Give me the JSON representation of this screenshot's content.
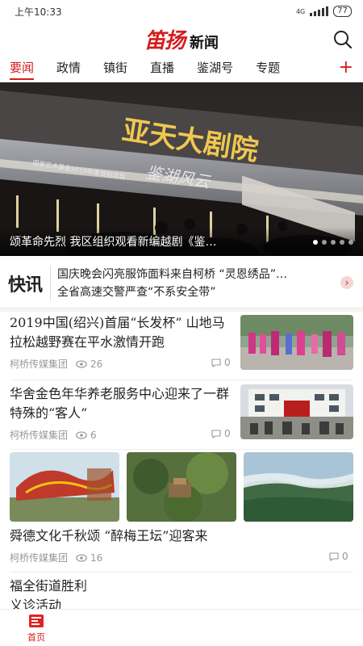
{
  "status": {
    "time": "上午10:33",
    "network": "4G",
    "battery": "77"
  },
  "header": {
    "logo_script": "笛扬",
    "logo_word": "新闻"
  },
  "tabs": [
    {
      "label": "要闻",
      "active": true
    },
    {
      "label": "政情",
      "active": false
    },
    {
      "label": "镇街",
      "active": false
    },
    {
      "label": "直播",
      "active": false
    },
    {
      "label": "鉴湖号",
      "active": false
    },
    {
      "label": "专题",
      "active": false
    }
  ],
  "tab_add": "+",
  "banner": {
    "sign_text": "亚天大剧院",
    "screen_text": "鉴湖风云",
    "screen_subtext": "国家艺术基金2019年度资助项目",
    "caption": "颂革命先烈 我区组织观看新编越剧《鉴…",
    "slide_count": 5,
    "active_slide": 1
  },
  "flash": {
    "label": "快讯",
    "lines": [
      "国庆晚会闪亮服饰面料来自柯桥 “灵恩绣品”…",
      "全省高速交警严查“不系安全带”"
    ]
  },
  "news": [
    {
      "title": "2019中国(绍兴)首届“长发杯” 山地马拉松越野赛在平水激情开跑",
      "source": "柯桥传媒集团",
      "views": "26",
      "comments": "0"
    },
    {
      "title": "华舍金色年华养老服务中心迎来了一群特殊的“客人”",
      "source": "柯桥传媒集团",
      "views": "6",
      "comments": "0"
    },
    {
      "title": "舜德文化千秋颂 “醉梅王坛”迎客来",
      "source": "柯桥传媒集团",
      "views": "16",
      "comments": "0"
    },
    {
      "title": "福全街道胜利社区开展义诊活动",
      "source": "",
      "views": "",
      "comments": ""
    }
  ],
  "news_last_lines": [
    "福全街道胜利",
    "义诊活动"
  ],
  "bottom_nav": {
    "home_label": "首页"
  },
  "colors": {
    "accent": "#d41c1c",
    "meta": "#999999"
  }
}
